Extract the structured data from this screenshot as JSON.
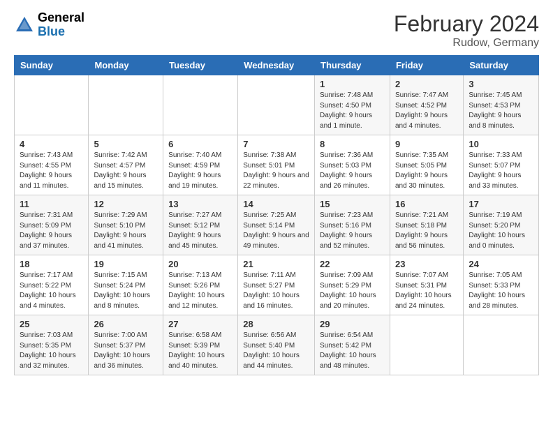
{
  "logo": {
    "text_general": "General",
    "text_blue": "Blue"
  },
  "title": "February 2024",
  "subtitle": "Rudow, Germany",
  "days_of_week": [
    "Sunday",
    "Monday",
    "Tuesday",
    "Wednesday",
    "Thursday",
    "Friday",
    "Saturday"
  ],
  "weeks": [
    [
      {
        "day": "",
        "detail": ""
      },
      {
        "day": "",
        "detail": ""
      },
      {
        "day": "",
        "detail": ""
      },
      {
        "day": "",
        "detail": ""
      },
      {
        "day": "1",
        "detail": "Sunrise: 7:48 AM\nSunset: 4:50 PM\nDaylight: 9 hours and 1 minute."
      },
      {
        "day": "2",
        "detail": "Sunrise: 7:47 AM\nSunset: 4:52 PM\nDaylight: 9 hours and 4 minutes."
      },
      {
        "day": "3",
        "detail": "Sunrise: 7:45 AM\nSunset: 4:53 PM\nDaylight: 9 hours and 8 minutes."
      }
    ],
    [
      {
        "day": "4",
        "detail": "Sunrise: 7:43 AM\nSunset: 4:55 PM\nDaylight: 9 hours and 11 minutes."
      },
      {
        "day": "5",
        "detail": "Sunrise: 7:42 AM\nSunset: 4:57 PM\nDaylight: 9 hours and 15 minutes."
      },
      {
        "day": "6",
        "detail": "Sunrise: 7:40 AM\nSunset: 4:59 PM\nDaylight: 9 hours and 19 minutes."
      },
      {
        "day": "7",
        "detail": "Sunrise: 7:38 AM\nSunset: 5:01 PM\nDaylight: 9 hours and 22 minutes."
      },
      {
        "day": "8",
        "detail": "Sunrise: 7:36 AM\nSunset: 5:03 PM\nDaylight: 9 hours and 26 minutes."
      },
      {
        "day": "9",
        "detail": "Sunrise: 7:35 AM\nSunset: 5:05 PM\nDaylight: 9 hours and 30 minutes."
      },
      {
        "day": "10",
        "detail": "Sunrise: 7:33 AM\nSunset: 5:07 PM\nDaylight: 9 hours and 33 minutes."
      }
    ],
    [
      {
        "day": "11",
        "detail": "Sunrise: 7:31 AM\nSunset: 5:09 PM\nDaylight: 9 hours and 37 minutes."
      },
      {
        "day": "12",
        "detail": "Sunrise: 7:29 AM\nSunset: 5:10 PM\nDaylight: 9 hours and 41 minutes."
      },
      {
        "day": "13",
        "detail": "Sunrise: 7:27 AM\nSunset: 5:12 PM\nDaylight: 9 hours and 45 minutes."
      },
      {
        "day": "14",
        "detail": "Sunrise: 7:25 AM\nSunset: 5:14 PM\nDaylight: 9 hours and 49 minutes."
      },
      {
        "day": "15",
        "detail": "Sunrise: 7:23 AM\nSunset: 5:16 PM\nDaylight: 9 hours and 52 minutes."
      },
      {
        "day": "16",
        "detail": "Sunrise: 7:21 AM\nSunset: 5:18 PM\nDaylight: 9 hours and 56 minutes."
      },
      {
        "day": "17",
        "detail": "Sunrise: 7:19 AM\nSunset: 5:20 PM\nDaylight: 10 hours and 0 minutes."
      }
    ],
    [
      {
        "day": "18",
        "detail": "Sunrise: 7:17 AM\nSunset: 5:22 PM\nDaylight: 10 hours and 4 minutes."
      },
      {
        "day": "19",
        "detail": "Sunrise: 7:15 AM\nSunset: 5:24 PM\nDaylight: 10 hours and 8 minutes."
      },
      {
        "day": "20",
        "detail": "Sunrise: 7:13 AM\nSunset: 5:26 PM\nDaylight: 10 hours and 12 minutes."
      },
      {
        "day": "21",
        "detail": "Sunrise: 7:11 AM\nSunset: 5:27 PM\nDaylight: 10 hours and 16 minutes."
      },
      {
        "day": "22",
        "detail": "Sunrise: 7:09 AM\nSunset: 5:29 PM\nDaylight: 10 hours and 20 minutes."
      },
      {
        "day": "23",
        "detail": "Sunrise: 7:07 AM\nSunset: 5:31 PM\nDaylight: 10 hours and 24 minutes."
      },
      {
        "day": "24",
        "detail": "Sunrise: 7:05 AM\nSunset: 5:33 PM\nDaylight: 10 hours and 28 minutes."
      }
    ],
    [
      {
        "day": "25",
        "detail": "Sunrise: 7:03 AM\nSunset: 5:35 PM\nDaylight: 10 hours and 32 minutes."
      },
      {
        "day": "26",
        "detail": "Sunrise: 7:00 AM\nSunset: 5:37 PM\nDaylight: 10 hours and 36 minutes."
      },
      {
        "day": "27",
        "detail": "Sunrise: 6:58 AM\nSunset: 5:39 PM\nDaylight: 10 hours and 40 minutes."
      },
      {
        "day": "28",
        "detail": "Sunrise: 6:56 AM\nSunset: 5:40 PM\nDaylight: 10 hours and 44 minutes."
      },
      {
        "day": "29",
        "detail": "Sunrise: 6:54 AM\nSunset: 5:42 PM\nDaylight: 10 hours and 48 minutes."
      },
      {
        "day": "",
        "detail": ""
      },
      {
        "day": "",
        "detail": ""
      }
    ]
  ]
}
